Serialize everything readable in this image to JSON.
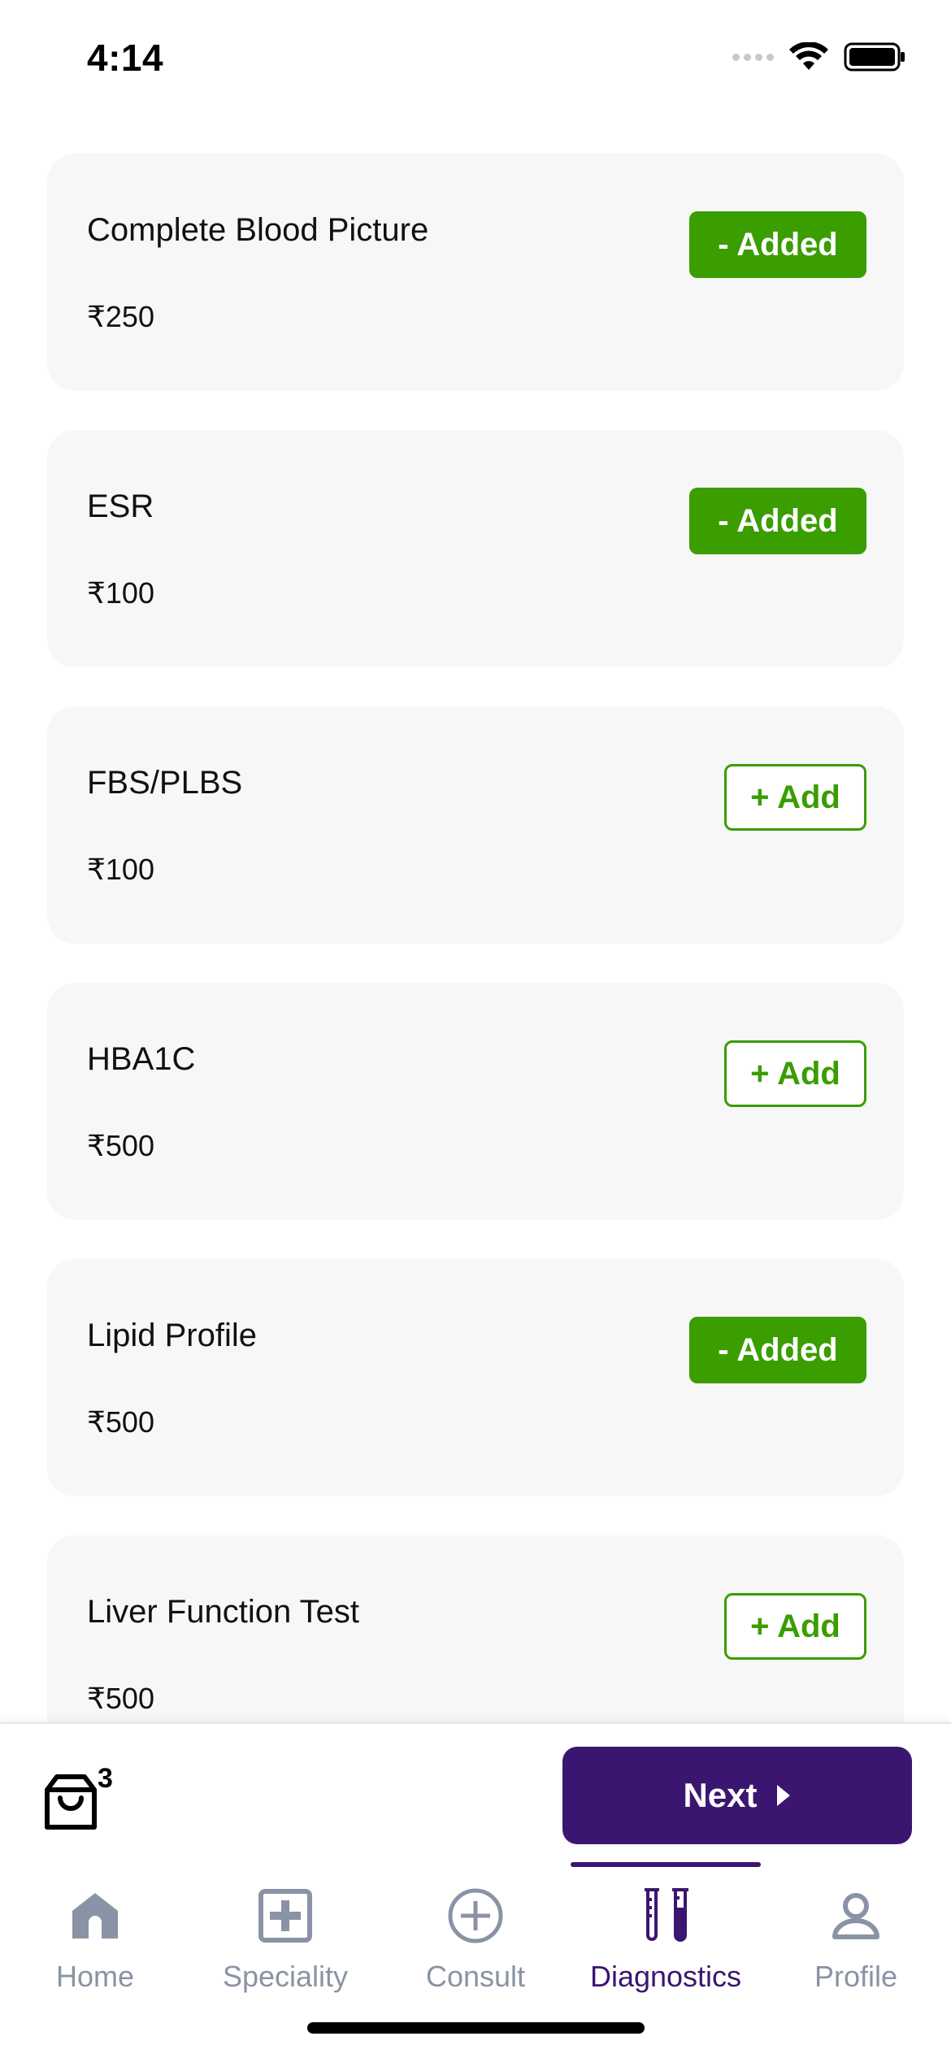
{
  "status_bar": {
    "time": "4:14"
  },
  "tests": [
    {
      "name": "Complete Blood Picture",
      "price": "₹250",
      "button": "- Added",
      "state": "added"
    },
    {
      "name": "ESR",
      "price": "₹100",
      "button": "- Added",
      "state": "added"
    },
    {
      "name": "FBS/PLBS",
      "price": "₹100",
      "button": "+ Add",
      "state": "add"
    },
    {
      "name": "HBA1C",
      "price": "₹500",
      "button": "+ Add",
      "state": "add"
    },
    {
      "name": "Lipid Profile",
      "price": "₹500",
      "button": "- Added",
      "state": "added"
    },
    {
      "name": "Liver Function Test",
      "price": "₹500",
      "button": "+ Add",
      "state": "add"
    }
  ],
  "action_bar": {
    "cart_count": "3",
    "next_label": "Next"
  },
  "tab_bar": {
    "tabs": [
      {
        "label": "Home",
        "icon": "home-icon"
      },
      {
        "label": "Speciality",
        "icon": "medical-plus-icon"
      },
      {
        "label": "Consult",
        "icon": "plus-circle-icon"
      },
      {
        "label": "Diagnostics",
        "icon": "test-tubes-icon"
      },
      {
        "label": "Profile",
        "icon": "person-icon"
      }
    ],
    "active": "Diagnostics"
  },
  "colors": {
    "accent": "#3b1670",
    "added_green": "#3a9d00",
    "card_bg": "#f7f7f7",
    "inactive_tab": "#8a93a5"
  }
}
